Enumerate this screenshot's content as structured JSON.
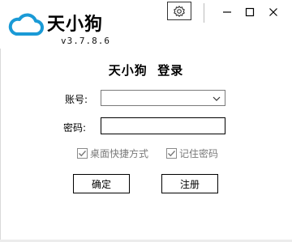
{
  "app": {
    "brand": "天小狗",
    "version": "v3.7.8.6"
  },
  "titlebar": {
    "settings_icon": "gear-icon",
    "minimize_icon": "minimize-icon",
    "maximize_icon": "maximize-icon",
    "close_icon": "close-icon"
  },
  "form": {
    "title_part1": "天小狗",
    "title_part2": "登录",
    "account_label": "账号:",
    "account_value": "",
    "password_label": "密码:",
    "password_value": "",
    "desktop_shortcut_label": "桌面快捷方式",
    "desktop_shortcut_checked": true,
    "remember_password_label": "记住密码",
    "remember_password_checked": true,
    "ok_button": "确定",
    "register_button": "注册"
  },
  "colors": {
    "logo_blue": "#1a9ad6",
    "disabled_text": "#7a7a7a"
  }
}
